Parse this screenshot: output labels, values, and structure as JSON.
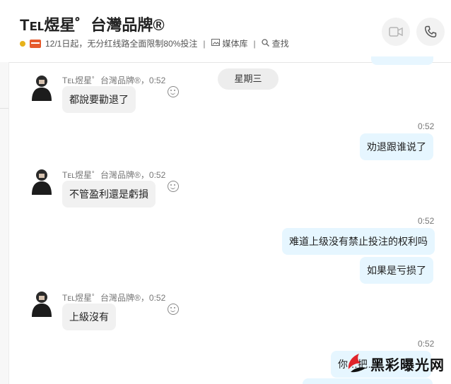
{
  "header": {
    "title": "Tᴇʟ煜星゜台灣品牌®",
    "notice_text": "12/1日起，无分红线路全面限制80%投注",
    "media_label": "媒体库",
    "search_label": "查找"
  },
  "day_divider": "星期三",
  "messages": [
    {
      "direction": "in",
      "sender": "Tᴇʟ煜星゜台灣品牌®，0:52",
      "text": "都說要勸退了"
    },
    {
      "direction": "out",
      "time": "0:52",
      "text": "劝退跟谁说了"
    },
    {
      "direction": "in",
      "sender": "Tᴇʟ煜星゜台灣品牌®，0:52",
      "text": "不管盈利還是虧損"
    },
    {
      "direction": "out",
      "time": "0:52",
      "text": "难道上级没有禁止投注的权利吗"
    },
    {
      "direction": "out",
      "text": "如果是亏损了"
    },
    {
      "direction": "in",
      "sender": "Tᴇʟ煜星゜台灣品牌®，0:52",
      "text": "上級沒有"
    },
    {
      "direction": "out",
      "time": "0:52",
      "text": "你…把…"
    }
  ],
  "watermark": "黑彩曝光网",
  "colors": {
    "incoming_bubble": "#f1f1f1",
    "outgoing_bubble": "#e6f6ff",
    "notice_dot": "#e7b21a",
    "watermark_logo": "#e0252b"
  }
}
